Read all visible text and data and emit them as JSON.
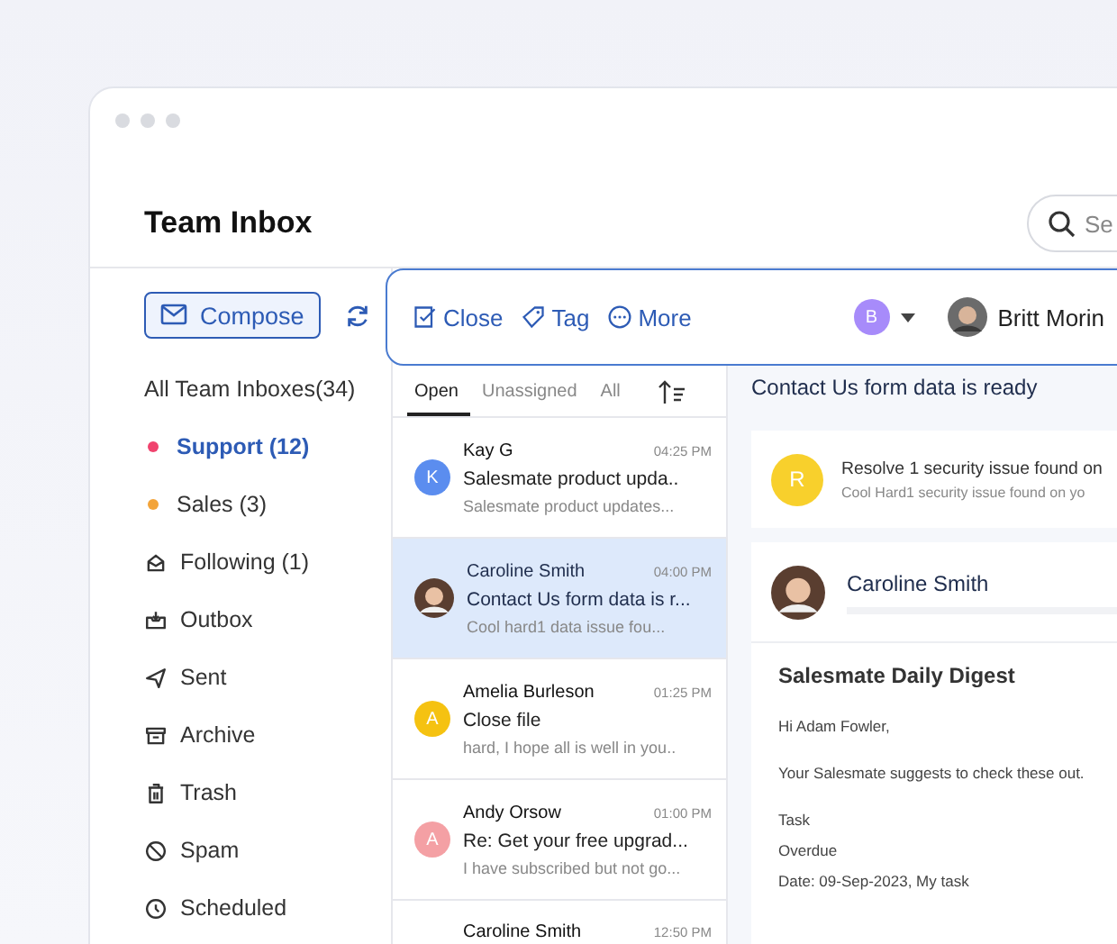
{
  "header": {
    "title": "Team Inbox",
    "search": {
      "placeholder": "Se"
    }
  },
  "compose": {
    "label": "Compose"
  },
  "sidebar": {
    "items": [
      {
        "kind": "plain",
        "label": "All Team Inboxes(34)",
        "selected": false
      },
      {
        "kind": "dot",
        "label": "Support (12)",
        "color": "#f0436e",
        "selected": true
      },
      {
        "kind": "dot",
        "label": "Sales (3)",
        "color": "#f3a43a",
        "selected": false
      },
      {
        "kind": "icon",
        "label": "Following (1)",
        "selected": false
      },
      {
        "kind": "icon",
        "label": "Outbox",
        "selected": false
      },
      {
        "kind": "icon",
        "label": "Sent",
        "selected": false
      },
      {
        "kind": "icon",
        "label": "Archive",
        "selected": false
      },
      {
        "kind": "icon",
        "label": "Trash",
        "selected": false
      },
      {
        "kind": "icon",
        "label": "Spam",
        "selected": false
      },
      {
        "kind": "icon",
        "label": "Scheduled",
        "selected": false
      }
    ]
  },
  "toolbar": {
    "actions": [
      "Close",
      "Tag",
      "More"
    ],
    "assignee": {
      "initial": "B",
      "color": "#a78bfa"
    },
    "user": {
      "name": "Britt Morin"
    }
  },
  "tabs": [
    {
      "label": "Open",
      "selected": true
    },
    {
      "label": "Unassigned",
      "selected": false
    },
    {
      "label": "All",
      "selected": false
    }
  ],
  "messages": [
    {
      "sender": "Kay G",
      "time": "04:25 PM",
      "subject": "Salesmate product upda..",
      "preview": "Salesmate product updates...",
      "avatar": {
        "kind": "initial",
        "initial": "K",
        "color": "#5b8def"
      },
      "selected": false
    },
    {
      "sender": "Caroline Smith",
      "time": "04:00 PM",
      "subject": "Contact Us form data is r...",
      "preview": "Cool hard1 data issue fou...",
      "avatar": {
        "kind": "photo"
      },
      "selected": true
    },
    {
      "sender": "Amelia Burleson",
      "time": "01:25 PM",
      "subject": "Close file",
      "preview": "hard, I hope all is well in you..",
      "avatar": {
        "kind": "initial",
        "initial": "A",
        "color": "#f5c211"
      },
      "selected": false
    },
    {
      "sender": "Andy Orsow",
      "time": "01:00 PM",
      "subject": "Re: Get your free upgrad...",
      "preview": "I have subscribed but not go...",
      "avatar": {
        "kind": "initial",
        "initial": "A",
        "color": "#f4a0a4"
      },
      "selected": false
    },
    {
      "sender": "Caroline Smith",
      "time": "12:50 PM",
      "avatar": {
        "kind": "hidden"
      },
      "selected": false
    }
  ],
  "detail": {
    "title": "Contact Us form data is ready",
    "notice": {
      "initial": "R",
      "color": "#f8d02c",
      "title": "Resolve 1 security issue found on",
      "preview": "Cool Hard1 security issue found on yo"
    },
    "email": {
      "from": "Caroline Smith",
      "heading": "Salesmate Daily Digest",
      "lines": [
        "Hi Adam Fowler,",
        "Your Salesmate suggests to check these out."
      ],
      "items": [
        "Task",
        "Overdue",
        "Date: 09-Sep-2023, My task"
      ]
    }
  }
}
